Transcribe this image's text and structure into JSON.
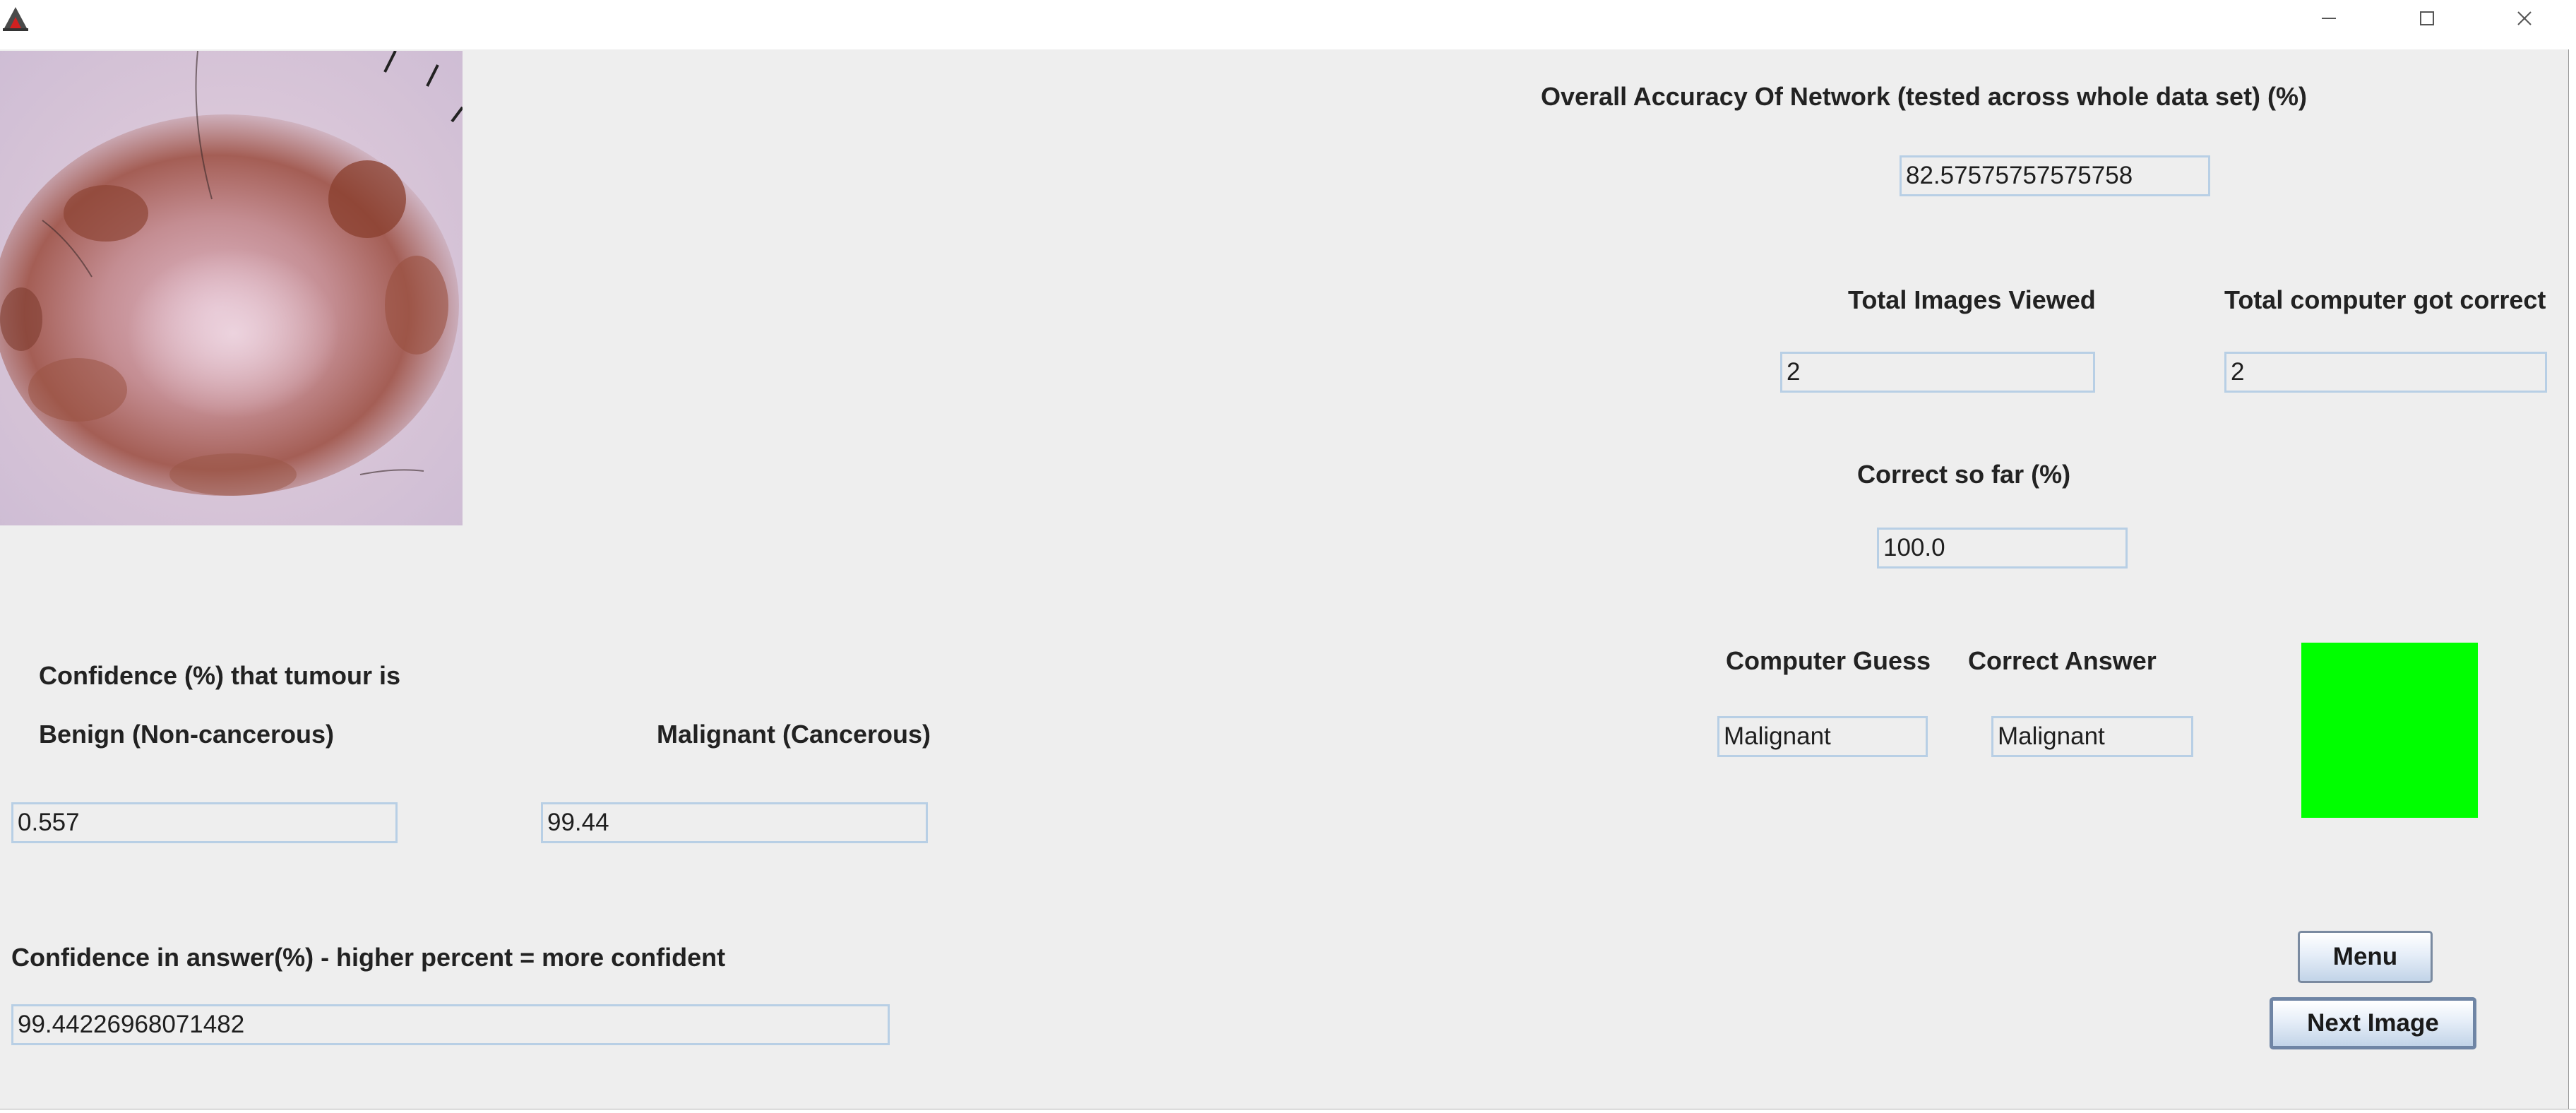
{
  "window": {
    "controls": [
      "minimize-icon",
      "maximize-icon",
      "close-icon"
    ]
  },
  "accuracy": {
    "label": "Overall Accuracy Of Network (tested across whole data set) (%)",
    "value": "82.57575757575758"
  },
  "stats": {
    "total_viewed_label": "Total Images Viewed",
    "total_viewed_value": "2",
    "total_correct_label": "Total computer got correct",
    "total_correct_value": "2",
    "correct_so_far_label": "Correct so far (%)",
    "correct_so_far_value": "100.0"
  },
  "result": {
    "guess_label": "Computer Guess",
    "guess_value": "Malignant",
    "answer_label": "Correct Answer",
    "answer_value": "Malignant",
    "indicator_color": "#00ff00"
  },
  "confidence": {
    "heading": "Confidence (%) that tumour is",
    "benign_label": "Benign (Non-cancerous)",
    "benign_value": "0.557",
    "malignant_label": "Malignant (Cancerous)",
    "malignant_value": "99.44",
    "answer_label": "Confidence in answer(%) - higher percent = more confident",
    "answer_value": "99.44226968071482"
  },
  "buttons": {
    "menu": "Menu",
    "next": "Next Image"
  },
  "colors": {
    "window_bg": "#eeeeee",
    "field_border": "#b8cfe5",
    "indicator": "#00ff00"
  }
}
